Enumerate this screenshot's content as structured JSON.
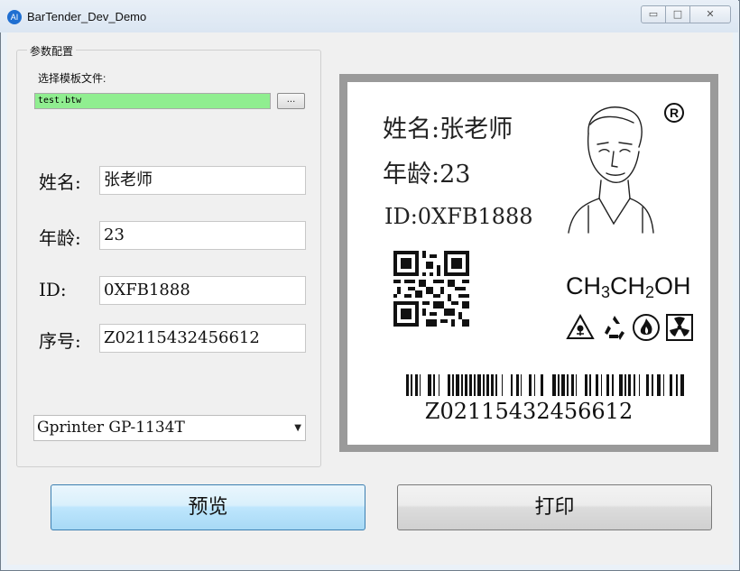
{
  "window": {
    "title": "BarTender_Dev_Demo",
    "app_icon_text": "AI",
    "min": "▭",
    "max": "□",
    "close": "✕"
  },
  "params": {
    "group_title": "参数配置",
    "template_label": "选择模板文件:",
    "template_file": "test.btw",
    "browse_label": "...",
    "fields": {
      "name_label": "姓名:",
      "name_value": "张老师",
      "age_label": "年龄:",
      "age_value": "23",
      "id_label": "ID:",
      "id_value": "0XFB1888",
      "serial_label": "序号:",
      "serial_value": "Z02115432456612"
    },
    "printer": "Gprinter GP-1134T"
  },
  "label_preview": {
    "name_line": "姓名:张老师",
    "age_line": "年龄:23",
    "id_line": "ID:0XFB1888",
    "registered_mark": "R",
    "formula_parts": [
      "CH",
      "3",
      "CH",
      "2",
      "OH"
    ],
    "hazard_icons": [
      "toxic-hazard-icon",
      "recycle-icon",
      "flammable-icon",
      "radiation-icon"
    ],
    "barcode_text": "Z02115432456612"
  },
  "buttons": {
    "preview": "预览",
    "print": "打印"
  }
}
